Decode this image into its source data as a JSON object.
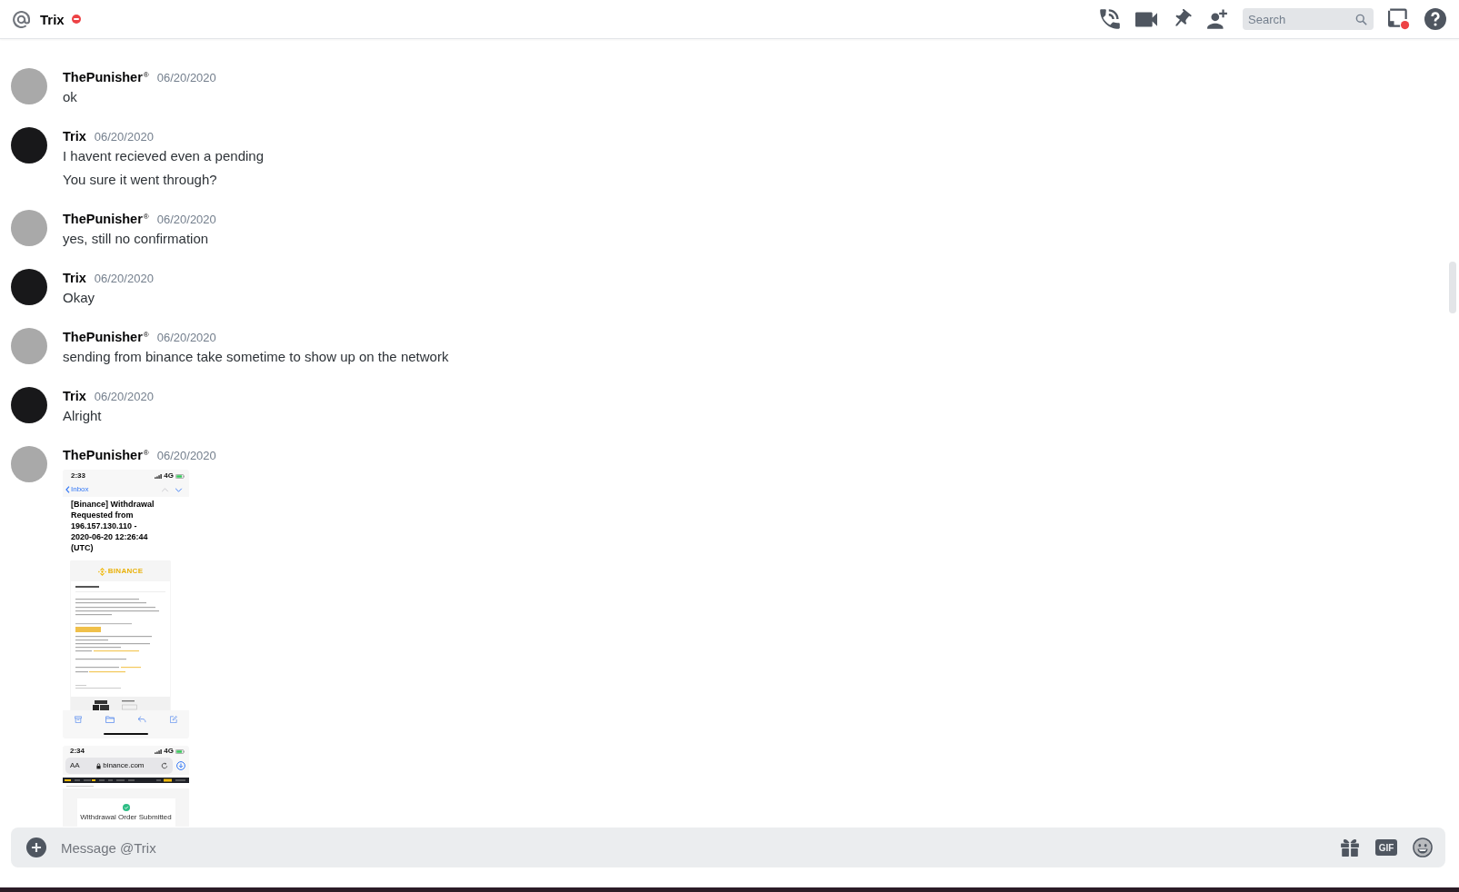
{
  "header": {
    "title": "Trix",
    "do_not_disturb": true,
    "search": {
      "placeholder": "Search"
    },
    "inbox": {
      "unread": true
    }
  },
  "messages": [
    {
      "author": "ThePunisher$^{®}$",
      "time": "06/20/2020",
      "avatar": {
        "color": "#a9a9a9"
      },
      "lines": [
        "ok"
      ]
    },
    {
      "author": "Trix",
      "time": "06/20/2020",
      "avatar": {
        "color": "#18181a"
      },
      "lines": [
        "I havent recieved even a pending",
        "You sure it went through?"
      ]
    },
    {
      "author": "ThePunisher$^{®}$",
      "time": "06/20/2020",
      "avatar": {
        "color": "#a9a9a9"
      },
      "lines": [
        "yes, still no confirmation"
      ]
    },
    {
      "author": "Trix",
      "time": "06/20/2020",
      "avatar": {
        "color": "#18181a"
      },
      "lines": [
        "Okay"
      ]
    },
    {
      "author": "ThePunisher$^{®}$",
      "time": "06/20/2020",
      "avatar": {
        "color": "#a9a9a9"
      },
      "lines": [
        "sending from binance take sometime to show up on the network"
      ]
    },
    {
      "author": "Trix",
      "time": "06/20/2020",
      "avatar": {
        "color": "#18181a"
      },
      "lines": [
        "Alright"
      ]
    },
    {
      "author": "ThePunisher$^{®}$",
      "time": "06/20/2020",
      "avatar": {
        "color": "#a9a9a9"
      },
      "attachments": [
        {
          "kind": "email",
          "time": "2:33",
          "network": "4G",
          "back": "Inbox",
          "subject": "[Binance] Withdrawal Requested from 196.157.130.110 - 2020-06-20 12:26:44 (UTC)",
          "brand": "BINANCE"
        },
        {
          "kind": "browser",
          "time": "2:34",
          "network": "4G",
          "text_size": "AA",
          "url": "binance.com",
          "notice": "Withdrawal Order Submitted"
        }
      ]
    }
  ],
  "composer": {
    "placeholder": "Message @Trix",
    "gif": "GIF"
  }
}
